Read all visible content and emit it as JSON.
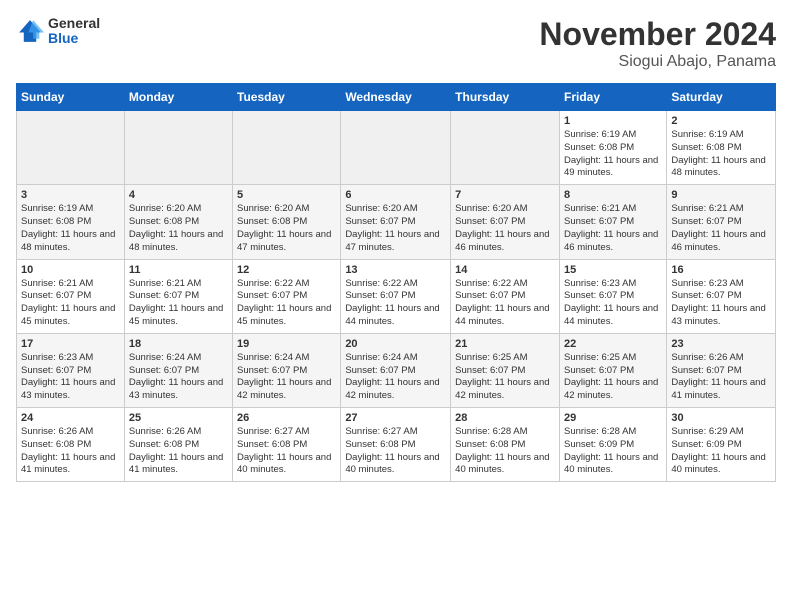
{
  "header": {
    "logo_general": "General",
    "logo_blue": "Blue",
    "month_title": "November 2024",
    "location": "Siogui Abajo, Panama"
  },
  "weekdays": [
    "Sunday",
    "Monday",
    "Tuesday",
    "Wednesday",
    "Thursday",
    "Friday",
    "Saturday"
  ],
  "weeks": [
    [
      {
        "day": "",
        "info": ""
      },
      {
        "day": "",
        "info": ""
      },
      {
        "day": "",
        "info": ""
      },
      {
        "day": "",
        "info": ""
      },
      {
        "day": "",
        "info": ""
      },
      {
        "day": "1",
        "info": "Sunrise: 6:19 AM\nSunset: 6:08 PM\nDaylight: 11 hours and 49 minutes."
      },
      {
        "day": "2",
        "info": "Sunrise: 6:19 AM\nSunset: 6:08 PM\nDaylight: 11 hours and 48 minutes."
      }
    ],
    [
      {
        "day": "3",
        "info": "Sunrise: 6:19 AM\nSunset: 6:08 PM\nDaylight: 11 hours and 48 minutes."
      },
      {
        "day": "4",
        "info": "Sunrise: 6:20 AM\nSunset: 6:08 PM\nDaylight: 11 hours and 48 minutes."
      },
      {
        "day": "5",
        "info": "Sunrise: 6:20 AM\nSunset: 6:08 PM\nDaylight: 11 hours and 47 minutes."
      },
      {
        "day": "6",
        "info": "Sunrise: 6:20 AM\nSunset: 6:07 PM\nDaylight: 11 hours and 47 minutes."
      },
      {
        "day": "7",
        "info": "Sunrise: 6:20 AM\nSunset: 6:07 PM\nDaylight: 11 hours and 46 minutes."
      },
      {
        "day": "8",
        "info": "Sunrise: 6:21 AM\nSunset: 6:07 PM\nDaylight: 11 hours and 46 minutes."
      },
      {
        "day": "9",
        "info": "Sunrise: 6:21 AM\nSunset: 6:07 PM\nDaylight: 11 hours and 46 minutes."
      }
    ],
    [
      {
        "day": "10",
        "info": "Sunrise: 6:21 AM\nSunset: 6:07 PM\nDaylight: 11 hours and 45 minutes."
      },
      {
        "day": "11",
        "info": "Sunrise: 6:21 AM\nSunset: 6:07 PM\nDaylight: 11 hours and 45 minutes."
      },
      {
        "day": "12",
        "info": "Sunrise: 6:22 AM\nSunset: 6:07 PM\nDaylight: 11 hours and 45 minutes."
      },
      {
        "day": "13",
        "info": "Sunrise: 6:22 AM\nSunset: 6:07 PM\nDaylight: 11 hours and 44 minutes."
      },
      {
        "day": "14",
        "info": "Sunrise: 6:22 AM\nSunset: 6:07 PM\nDaylight: 11 hours and 44 minutes."
      },
      {
        "day": "15",
        "info": "Sunrise: 6:23 AM\nSunset: 6:07 PM\nDaylight: 11 hours and 44 minutes."
      },
      {
        "day": "16",
        "info": "Sunrise: 6:23 AM\nSunset: 6:07 PM\nDaylight: 11 hours and 43 minutes."
      }
    ],
    [
      {
        "day": "17",
        "info": "Sunrise: 6:23 AM\nSunset: 6:07 PM\nDaylight: 11 hours and 43 minutes."
      },
      {
        "day": "18",
        "info": "Sunrise: 6:24 AM\nSunset: 6:07 PM\nDaylight: 11 hours and 43 minutes."
      },
      {
        "day": "19",
        "info": "Sunrise: 6:24 AM\nSunset: 6:07 PM\nDaylight: 11 hours and 42 minutes."
      },
      {
        "day": "20",
        "info": "Sunrise: 6:24 AM\nSunset: 6:07 PM\nDaylight: 11 hours and 42 minutes."
      },
      {
        "day": "21",
        "info": "Sunrise: 6:25 AM\nSunset: 6:07 PM\nDaylight: 11 hours and 42 minutes."
      },
      {
        "day": "22",
        "info": "Sunrise: 6:25 AM\nSunset: 6:07 PM\nDaylight: 11 hours and 42 minutes."
      },
      {
        "day": "23",
        "info": "Sunrise: 6:26 AM\nSunset: 6:07 PM\nDaylight: 11 hours and 41 minutes."
      }
    ],
    [
      {
        "day": "24",
        "info": "Sunrise: 6:26 AM\nSunset: 6:08 PM\nDaylight: 11 hours and 41 minutes."
      },
      {
        "day": "25",
        "info": "Sunrise: 6:26 AM\nSunset: 6:08 PM\nDaylight: 11 hours and 41 minutes."
      },
      {
        "day": "26",
        "info": "Sunrise: 6:27 AM\nSunset: 6:08 PM\nDaylight: 11 hours and 40 minutes."
      },
      {
        "day": "27",
        "info": "Sunrise: 6:27 AM\nSunset: 6:08 PM\nDaylight: 11 hours and 40 minutes."
      },
      {
        "day": "28",
        "info": "Sunrise: 6:28 AM\nSunset: 6:08 PM\nDaylight: 11 hours and 40 minutes."
      },
      {
        "day": "29",
        "info": "Sunrise: 6:28 AM\nSunset: 6:09 PM\nDaylight: 11 hours and 40 minutes."
      },
      {
        "day": "30",
        "info": "Sunrise: 6:29 AM\nSunset: 6:09 PM\nDaylight: 11 hours and 40 minutes."
      }
    ]
  ]
}
